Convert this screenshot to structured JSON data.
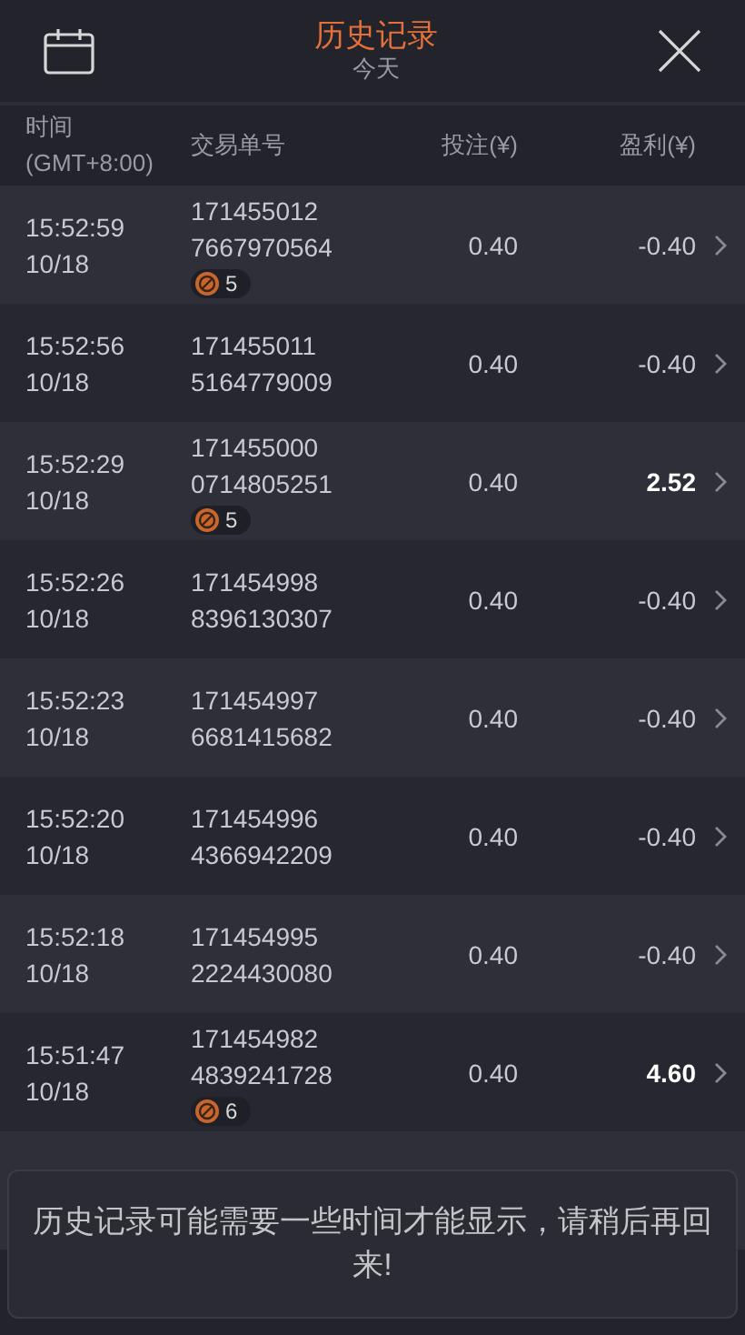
{
  "header": {
    "title": "历史记录",
    "subtitle": "今天"
  },
  "columns": [
    "时间\n(GMT+8:00)",
    "交易单号",
    "投注(¥)",
    "盈利(¥)"
  ],
  "rows": [
    {
      "time": "15:52:59",
      "date": "10/18",
      "id_1": "171455012",
      "id_2": "7667970564",
      "badge": "5",
      "stake": "0.40",
      "profit": "-0.40",
      "win": false
    },
    {
      "time": "15:52:56",
      "date": "10/18",
      "id_1": "171455011",
      "id_2": "5164779009",
      "stake": "0.40",
      "profit": "-0.40",
      "win": false
    },
    {
      "time": "15:52:29",
      "date": "10/18",
      "id_1": "171455000",
      "id_2": "0714805251",
      "badge": "5",
      "stake": "0.40",
      "profit": "2.52",
      "win": true
    },
    {
      "time": "15:52:26",
      "date": "10/18",
      "id_1": "171454998",
      "id_2": "8396130307",
      "stake": "0.40",
      "profit": "-0.40",
      "win": false
    },
    {
      "time": "15:52:23",
      "date": "10/18",
      "id_1": "171454997",
      "id_2": "6681415682",
      "stake": "0.40",
      "profit": "-0.40",
      "win": false
    },
    {
      "time": "15:52:20",
      "date": "10/18",
      "id_1": "171454996",
      "id_2": "4366942209",
      "stake": "0.40",
      "profit": "-0.40",
      "win": false
    },
    {
      "time": "15:52:18",
      "date": "10/18",
      "id_1": "171454995",
      "id_2": "2224430080",
      "stake": "0.40",
      "profit": "-0.40",
      "win": false
    },
    {
      "time": "15:51:47",
      "date": "10/18",
      "id_1": "171454982",
      "id_2": "4839241728",
      "badge": "6",
      "stake": "0.40",
      "profit": "4.60",
      "win": true
    }
  ],
  "toast": "历史记录可能需要一些时间才能显示，请稍后再回来!"
}
